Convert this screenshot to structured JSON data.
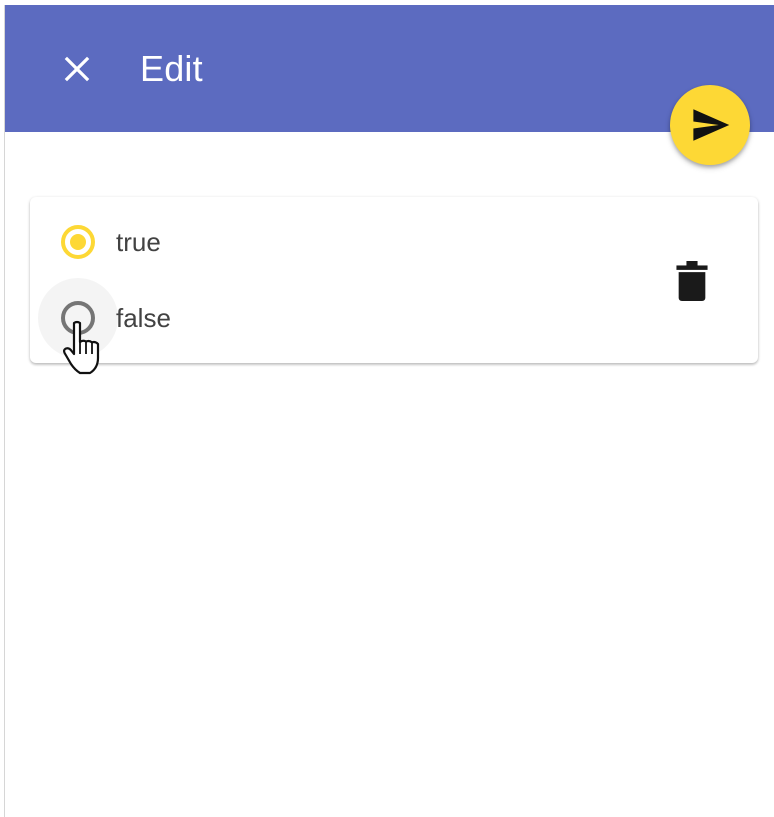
{
  "appbar": {
    "title": "Edit",
    "close_icon": "close-icon",
    "submit_icon": "send-icon"
  },
  "options": {
    "selected": "true",
    "items": [
      {
        "label": "true",
        "checked": true
      },
      {
        "label": "false",
        "checked": false
      }
    ]
  },
  "actions": {
    "delete_icon": "trash-icon"
  },
  "colors": {
    "appbar": "#5c6bc0",
    "accent": "#fdd835",
    "radio_unchecked": "#757575",
    "label_text": "#424242"
  }
}
